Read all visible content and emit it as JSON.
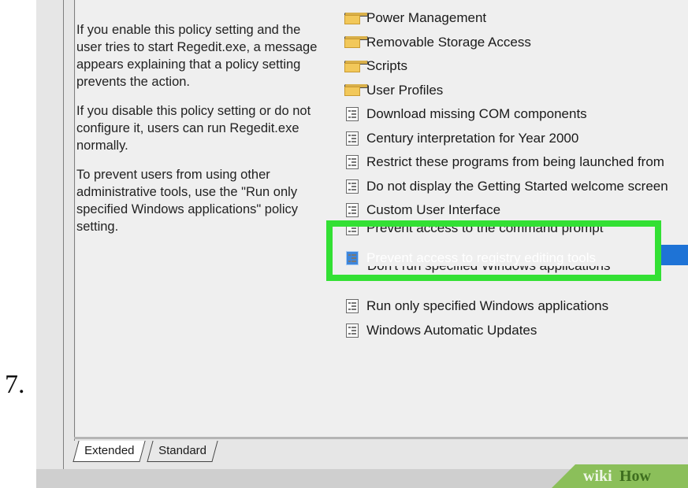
{
  "step_number": "7.",
  "description": {
    "paragraphs": [
      "If you enable this policy setting and the user tries to start Regedit.exe, a message appears explaining that a policy setting prevents the action.",
      "If you disable this policy setting or do not configure it, users can run Regedit.exe normally.",
      "To prevent users from using other administrative tools, use the \"Run only specified Windows applications\" policy setting."
    ]
  },
  "folders": [
    {
      "label": "Power Management",
      "icon": "folder-icon"
    },
    {
      "label": "Removable Storage Access",
      "icon": "folder-icon"
    },
    {
      "label": "Scripts",
      "icon": "folder-icon"
    },
    {
      "label": "User Profiles",
      "icon": "folder-icon"
    }
  ],
  "settings": [
    {
      "label": "Download missing COM components",
      "icon": "policy-setting-icon"
    },
    {
      "label": "Century interpretation for Year 2000",
      "icon": "policy-setting-icon"
    },
    {
      "label": "Restrict these programs from being launched from",
      "icon": "policy-setting-icon"
    },
    {
      "label": "Do not display the Getting Started welcome screen",
      "icon": "policy-setting-icon"
    },
    {
      "label": "Custom User Interface",
      "icon": "policy-setting-icon"
    },
    {
      "label": "Prevent access to the command prompt",
      "icon": "policy-setting-icon"
    },
    {
      "label": "Prevent access to registry editing tools",
      "icon": "policy-setting-icon",
      "selected": true
    },
    {
      "label": "Don't run specified Windows applications",
      "icon": "policy-setting-icon"
    },
    {
      "label": "Run only specified Windows applications",
      "icon": "policy-setting-icon"
    },
    {
      "label": "Windows Automatic Updates",
      "icon": "policy-setting-icon"
    }
  ],
  "tabs": [
    {
      "label": "Extended",
      "active": true
    },
    {
      "label": "Standard",
      "active": false
    }
  ],
  "watermark": {
    "wiki": "wiki",
    "how": "How"
  },
  "colors": {
    "selection": "#1e73d6",
    "highlight_box": "#33e034",
    "pane_background": "#efefef",
    "folder": "#f2c85a"
  }
}
